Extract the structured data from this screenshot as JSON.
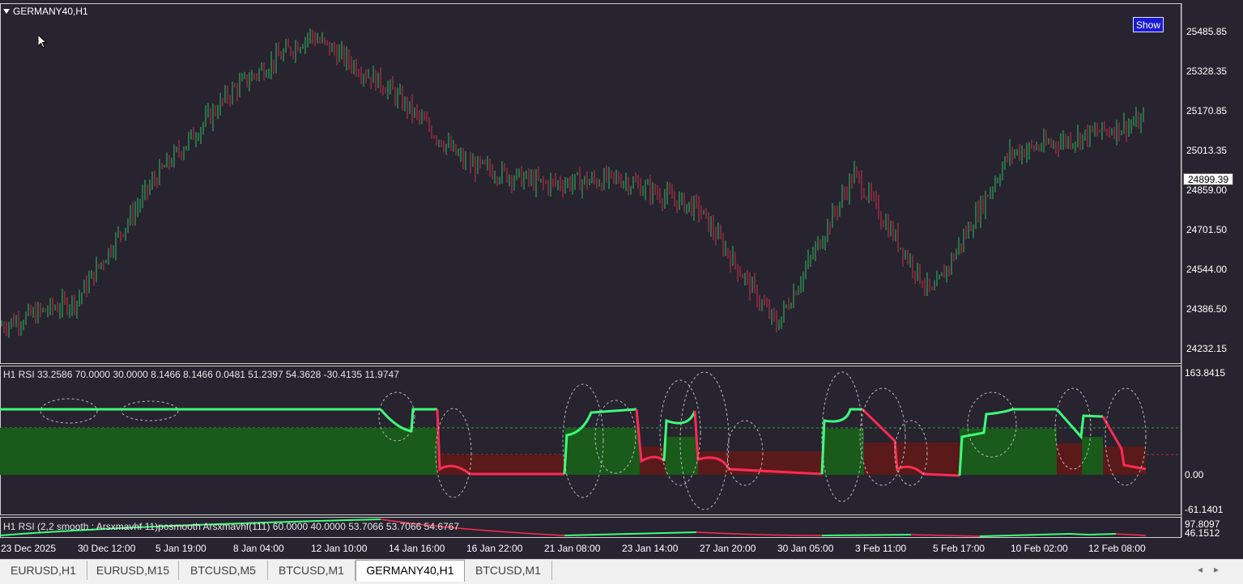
{
  "window": {
    "symbol_title": "GERMANY40,H1",
    "show_button": "Show",
    "current_price": "24899.39"
  },
  "main_chart": {
    "price_axis": [
      "25485.85",
      "25328.35",
      "25170.85",
      "25013.35",
      "24859.00",
      "24701.50",
      "24544.00",
      "24386.50",
      "24232.15"
    ],
    "colors": {
      "background": "#27232f",
      "bull": "#2fbf5f",
      "bear": "#d1304d"
    }
  },
  "indicator1": {
    "label": "H1 RSI  33.2586 70.0000 30.0000 8.1466 8.1466 0.0481 51.2397 54.3628 -30.4135 11.9747",
    "axis": [
      "163.8415",
      "0.00",
      "-61.1401"
    ]
  },
  "indicator2": {
    "label": "H1 RSI (2,2 smooth : Arsxmavhf  11)posmooth Arsxmavhf(111) 60.0000 40.0000 53.7066 53.7066 54.6767",
    "axis": [
      "97.8097",
      "46.1512"
    ]
  },
  "time_axis": [
    "23 Dec 2025",
    "30 Dec 12:00",
    "5 Jan 19:00",
    "8 Jan 04:00",
    "12 Jan 10:00",
    "14 Jan 16:00",
    "16 Jan 22:00",
    "21 Jan 08:00",
    "23 Jan 14:00",
    "27 Jan 20:00",
    "30 Jan 05:00",
    "3 Feb 11:00",
    "5 Feb 17:00",
    "10 Feb 02:00",
    "12 Feb 08:00"
  ],
  "tabs": [
    {
      "label": "EURUSD,H1",
      "active": false
    },
    {
      "label": "EURUSD,M15",
      "active": false
    },
    {
      "label": "BTCUSD,M5",
      "active": false
    },
    {
      "label": "BTCUSD,M1",
      "active": false
    },
    {
      "label": "GERMANY40,H1",
      "active": true
    },
    {
      "label": "BTCUSD,M1",
      "active": false
    }
  ],
  "chart_data": {
    "type": "line",
    "title": "GERMANY40,H1",
    "x": [
      "23 Dec 2025",
      "30 Dec 12:00",
      "5 Jan 19:00",
      "8 Jan 04:00",
      "12 Jan 10:00",
      "14 Jan 16:00",
      "16 Jan 22:00",
      "21 Jan 08:00",
      "23 Jan 14:00",
      "27 Jan 20:00",
      "30 Jan 05:00",
      "3 Feb 11:00",
      "5 Feb 17:00",
      "10 Feb 02:00",
      "12 Feb 08:00"
    ],
    "series": [
      {
        "values": [
          24320,
          24420,
          24900,
          25250,
          25470,
          25260,
          24960,
          24880,
          24900,
          24780,
          24320,
          24920,
          24440,
          25000,
          25130
        ]
      }
    ],
    "ylim": [
      24200,
      25540
    ]
  }
}
